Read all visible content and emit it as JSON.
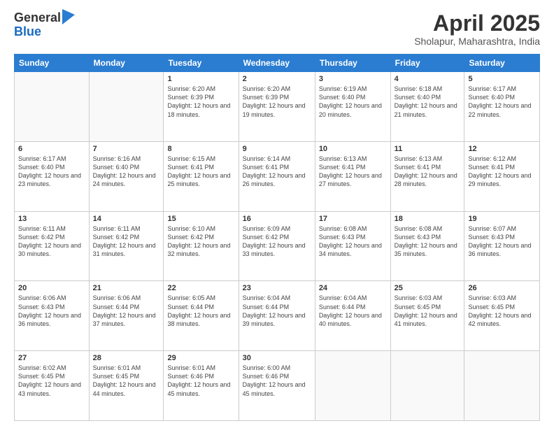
{
  "logo": {
    "general": "General",
    "blue": "Blue"
  },
  "header": {
    "month_year": "April 2025",
    "location": "Sholapur, Maharashtra, India"
  },
  "weekdays": [
    "Sunday",
    "Monday",
    "Tuesday",
    "Wednesday",
    "Thursday",
    "Friday",
    "Saturday"
  ],
  "weeks": [
    [
      {
        "day": "",
        "info": ""
      },
      {
        "day": "",
        "info": ""
      },
      {
        "day": "1",
        "info": "Sunrise: 6:20 AM\nSunset: 6:39 PM\nDaylight: 12 hours and 18 minutes."
      },
      {
        "day": "2",
        "info": "Sunrise: 6:20 AM\nSunset: 6:39 PM\nDaylight: 12 hours and 19 minutes."
      },
      {
        "day": "3",
        "info": "Sunrise: 6:19 AM\nSunset: 6:40 PM\nDaylight: 12 hours and 20 minutes."
      },
      {
        "day": "4",
        "info": "Sunrise: 6:18 AM\nSunset: 6:40 PM\nDaylight: 12 hours and 21 minutes."
      },
      {
        "day": "5",
        "info": "Sunrise: 6:17 AM\nSunset: 6:40 PM\nDaylight: 12 hours and 22 minutes."
      }
    ],
    [
      {
        "day": "6",
        "info": "Sunrise: 6:17 AM\nSunset: 6:40 PM\nDaylight: 12 hours and 23 minutes."
      },
      {
        "day": "7",
        "info": "Sunrise: 6:16 AM\nSunset: 6:40 PM\nDaylight: 12 hours and 24 minutes."
      },
      {
        "day": "8",
        "info": "Sunrise: 6:15 AM\nSunset: 6:41 PM\nDaylight: 12 hours and 25 minutes."
      },
      {
        "day": "9",
        "info": "Sunrise: 6:14 AM\nSunset: 6:41 PM\nDaylight: 12 hours and 26 minutes."
      },
      {
        "day": "10",
        "info": "Sunrise: 6:13 AM\nSunset: 6:41 PM\nDaylight: 12 hours and 27 minutes."
      },
      {
        "day": "11",
        "info": "Sunrise: 6:13 AM\nSunset: 6:41 PM\nDaylight: 12 hours and 28 minutes."
      },
      {
        "day": "12",
        "info": "Sunrise: 6:12 AM\nSunset: 6:41 PM\nDaylight: 12 hours and 29 minutes."
      }
    ],
    [
      {
        "day": "13",
        "info": "Sunrise: 6:11 AM\nSunset: 6:42 PM\nDaylight: 12 hours and 30 minutes."
      },
      {
        "day": "14",
        "info": "Sunrise: 6:11 AM\nSunset: 6:42 PM\nDaylight: 12 hours and 31 minutes."
      },
      {
        "day": "15",
        "info": "Sunrise: 6:10 AM\nSunset: 6:42 PM\nDaylight: 12 hours and 32 minutes."
      },
      {
        "day": "16",
        "info": "Sunrise: 6:09 AM\nSunset: 6:42 PM\nDaylight: 12 hours and 33 minutes."
      },
      {
        "day": "17",
        "info": "Sunrise: 6:08 AM\nSunset: 6:43 PM\nDaylight: 12 hours and 34 minutes."
      },
      {
        "day": "18",
        "info": "Sunrise: 6:08 AM\nSunset: 6:43 PM\nDaylight: 12 hours and 35 minutes."
      },
      {
        "day": "19",
        "info": "Sunrise: 6:07 AM\nSunset: 6:43 PM\nDaylight: 12 hours and 36 minutes."
      }
    ],
    [
      {
        "day": "20",
        "info": "Sunrise: 6:06 AM\nSunset: 6:43 PM\nDaylight: 12 hours and 36 minutes."
      },
      {
        "day": "21",
        "info": "Sunrise: 6:06 AM\nSunset: 6:44 PM\nDaylight: 12 hours and 37 minutes."
      },
      {
        "day": "22",
        "info": "Sunrise: 6:05 AM\nSunset: 6:44 PM\nDaylight: 12 hours and 38 minutes."
      },
      {
        "day": "23",
        "info": "Sunrise: 6:04 AM\nSunset: 6:44 PM\nDaylight: 12 hours and 39 minutes."
      },
      {
        "day": "24",
        "info": "Sunrise: 6:04 AM\nSunset: 6:44 PM\nDaylight: 12 hours and 40 minutes."
      },
      {
        "day": "25",
        "info": "Sunrise: 6:03 AM\nSunset: 6:45 PM\nDaylight: 12 hours and 41 minutes."
      },
      {
        "day": "26",
        "info": "Sunrise: 6:03 AM\nSunset: 6:45 PM\nDaylight: 12 hours and 42 minutes."
      }
    ],
    [
      {
        "day": "27",
        "info": "Sunrise: 6:02 AM\nSunset: 6:45 PM\nDaylight: 12 hours and 43 minutes."
      },
      {
        "day": "28",
        "info": "Sunrise: 6:01 AM\nSunset: 6:45 PM\nDaylight: 12 hours and 44 minutes."
      },
      {
        "day": "29",
        "info": "Sunrise: 6:01 AM\nSunset: 6:46 PM\nDaylight: 12 hours and 45 minutes."
      },
      {
        "day": "30",
        "info": "Sunrise: 6:00 AM\nSunset: 6:46 PM\nDaylight: 12 hours and 45 minutes."
      },
      {
        "day": "",
        "info": ""
      },
      {
        "day": "",
        "info": ""
      },
      {
        "day": "",
        "info": ""
      }
    ]
  ]
}
